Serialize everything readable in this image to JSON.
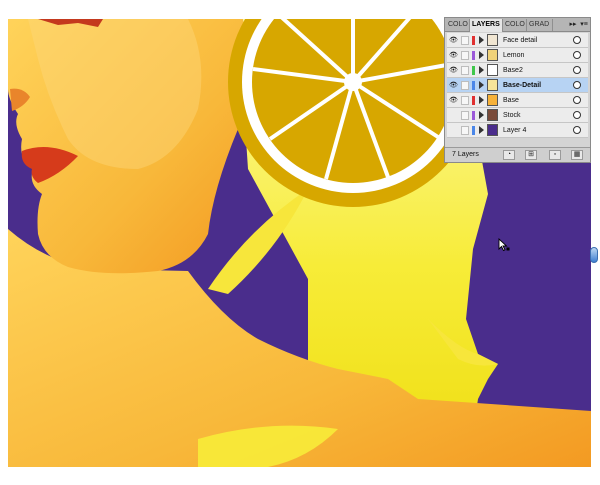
{
  "panel": {
    "tabs": [
      {
        "label": "COLO",
        "active": false
      },
      {
        "label": "LAYERS",
        "active": true
      },
      {
        "label": "COLO",
        "active": false
      },
      {
        "label": "GRAD",
        "active": false
      }
    ],
    "collapse_glyph": "▸▸",
    "menu_glyph": "▾≡",
    "layers": [
      {
        "name": "Face detail",
        "color": "#e03030",
        "thumb": "#f1e6d2",
        "selected": false
      },
      {
        "name": "Lemon",
        "color": "#9b59d9",
        "thumb": "#f0d27a",
        "selected": false
      },
      {
        "name": "Base2",
        "color": "#3fc74a",
        "thumb": "#ffffff",
        "selected": false
      },
      {
        "name": "Base-Detail",
        "color": "#4a86e8",
        "thumb": "#f6e49a",
        "selected": true
      },
      {
        "name": "Base",
        "color": "#e03030",
        "thumb": "#f7b23a",
        "selected": false
      },
      {
        "name": "Stock",
        "color": "#9b59d9",
        "thumb": "#7a4b3a",
        "selected": false
      },
      {
        "name": "Layer 4",
        "color": "#4a86e8",
        "thumb": "#4a2d8c",
        "selected": false
      }
    ],
    "footer": {
      "layer_count": "7 Layers"
    }
  },
  "icons": {
    "eye": "eye-icon",
    "expand": "disclosure-triangle-icon",
    "target": "target-circle-icon",
    "footer_buttons": [
      "make-clipping-mask-icon",
      "create-sublayer-icon",
      "new-layer-icon",
      "trash-icon"
    ],
    "cursor": "arrow-cursor-icon"
  },
  "colors": {
    "background": "#4a2d8c",
    "lemon": "#d7a700",
    "lemon_rind": "#ffffff",
    "hair": "#f8e94a",
    "skin": "#f7b23a",
    "lips": "#d63b1b",
    "selection": "#b7d3f3"
  }
}
